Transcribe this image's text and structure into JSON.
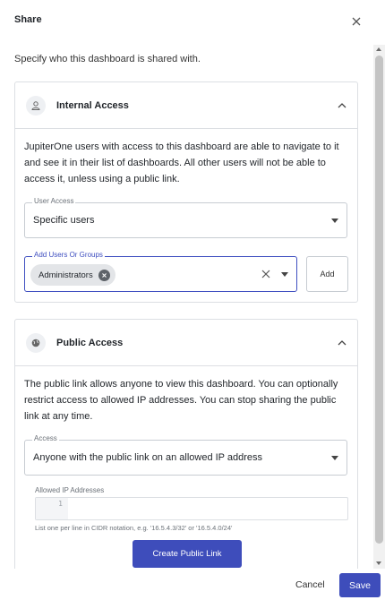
{
  "dialog": {
    "title": "Share",
    "intro": "Specify who this dashboard is shared with."
  },
  "internal_access": {
    "title": "Internal Access",
    "icon": "user-icon",
    "description": "JupiterOne users with access to this dashboard are able to navigate to it and see it in their list of dashboards. All other users will not be able to access it, unless using a public link.",
    "user_access": {
      "label": "User Access",
      "value": "Specific users"
    },
    "add_users": {
      "label": "Add Users Or Groups",
      "chips": [
        "Administrators"
      ],
      "add_label": "Add"
    }
  },
  "public_access": {
    "title": "Public Access",
    "icon": "globe-icon",
    "description": "The public link allows anyone to view this dashboard. You can optionally restrict access to allowed IP addresses. You can stop sharing the public link at any time.",
    "access": {
      "label": "Access",
      "value": "Anyone with the public link on an allowed IP address"
    },
    "allowed_ip": {
      "label": "Allowed IP Addresses",
      "line_number": "1",
      "hint": "List one per line in CIDR notation, e.g. '16.5.4.3/32' or '16.5.4.0/24'"
    },
    "create_label": "Create Public Link"
  },
  "footer": {
    "cancel_label": "Cancel",
    "save_label": "Save"
  },
  "colors": {
    "primary": "#3e4dbb",
    "focus_border": "#3f4fc0",
    "border": "#dcdfe3"
  }
}
